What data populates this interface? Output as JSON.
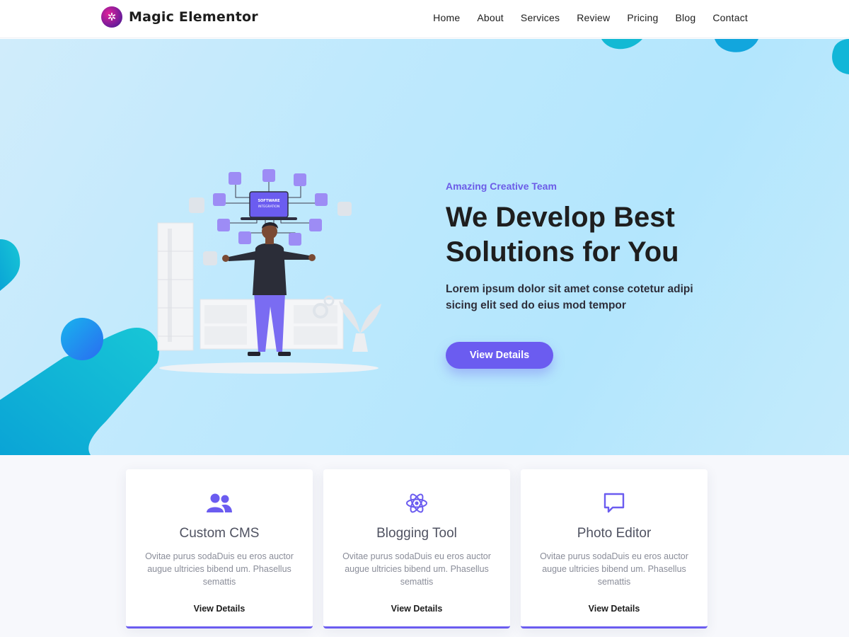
{
  "brand": {
    "name": "Magic Elementor",
    "logo_icon": "magic-wand-icon"
  },
  "nav": {
    "items": [
      "Home",
      "About",
      "Services",
      "Review",
      "Pricing",
      "Blog",
      "Contact"
    ]
  },
  "hero": {
    "eyebrow": "Amazing Creative Team",
    "headline_line1": "We Develop Best",
    "headline_line2": "Solutions for You",
    "lead": "Lorem ipsum dolor sit amet conse cotetur adipi sicing elit sed do eius mod tempor",
    "cta": "View Details",
    "illustration_label_1": "SOFTWARE",
    "illustration_label_2": "INTEGRATION"
  },
  "colors": {
    "accent": "#6b5cf0",
    "hero_bg": "#bfe9fd",
    "blob": "#12b6d8"
  },
  "features": [
    {
      "icon": "users-icon",
      "title": "Custom CMS",
      "desc": "Ovitae purus sodaDuis eu eros auctor augue ultricies bibend um. Phasellus semattis",
      "link": "View Details"
    },
    {
      "icon": "atom-icon",
      "title": "Blogging Tool",
      "desc": "Ovitae purus sodaDuis eu eros auctor augue ultricies bibend um. Phasellus semattis",
      "link": "View Details"
    },
    {
      "icon": "chat-icon",
      "title": "Photo Editor",
      "desc": "Ovitae purus sodaDuis eu eros auctor augue ultricies bibend um. Phasellus semattis",
      "link": "View Details"
    }
  ]
}
